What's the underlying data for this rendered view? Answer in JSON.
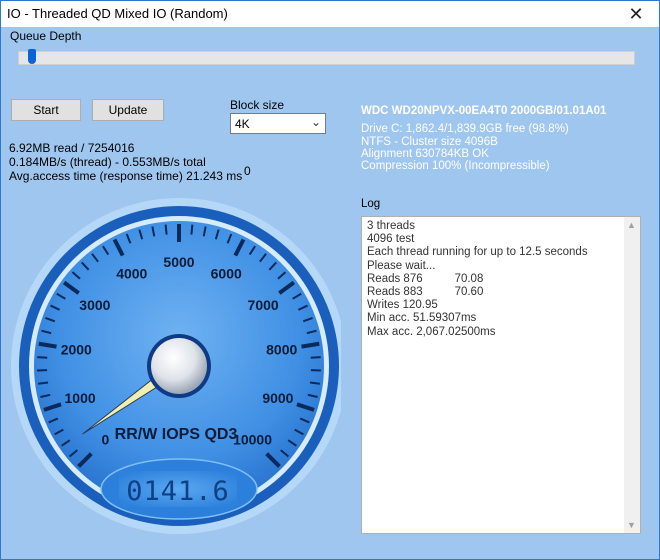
{
  "window": {
    "title": "IO - Threaded QD Mixed IO (Random)"
  },
  "queue_depth": {
    "label": "Queue Depth"
  },
  "buttons": {
    "start": "Start",
    "update": "Update"
  },
  "block_size": {
    "label": "Block size",
    "value": "4K"
  },
  "stats": {
    "line1": "6.92MB read / 7254016",
    "line2": "0.184MB/s (thread) - 0.553MB/s total",
    "line3": "Avg.access time (response time) 21.243 ms",
    "counter": "0"
  },
  "drive": {
    "model": "WDC WD20NPVX-00EA4T0 2000GB/01.01A01",
    "lines": [
      "Drive C: 1,862.4/1,839.9GB free (98.8%)",
      "NTFS - Cluster size 4096B",
      "Alignment 630784KB OK",
      "Compression 100% (Incompressible)"
    ]
  },
  "log": {
    "label": "Log",
    "lines": [
      "3 threads",
      "4096 test",
      "Each thread running for up to 12.5 seconds",
      "Please wait...",
      "Reads 876          70.08",
      "Reads 883          70.60",
      "Writes 120.95",
      "Min acc. 51.59307ms",
      "Max acc. 2,067.02500ms"
    ]
  },
  "gauge": {
    "title": "RR/W IOPS QD3",
    "scale_min": 0,
    "scale_max": 10000,
    "scale_labels": [
      "0",
      "1000",
      "2000",
      "3000",
      "4000",
      "5000",
      "6000",
      "7000",
      "8000",
      "9000",
      "10000"
    ],
    "value": 141.6,
    "readout": "0141.6"
  }
}
